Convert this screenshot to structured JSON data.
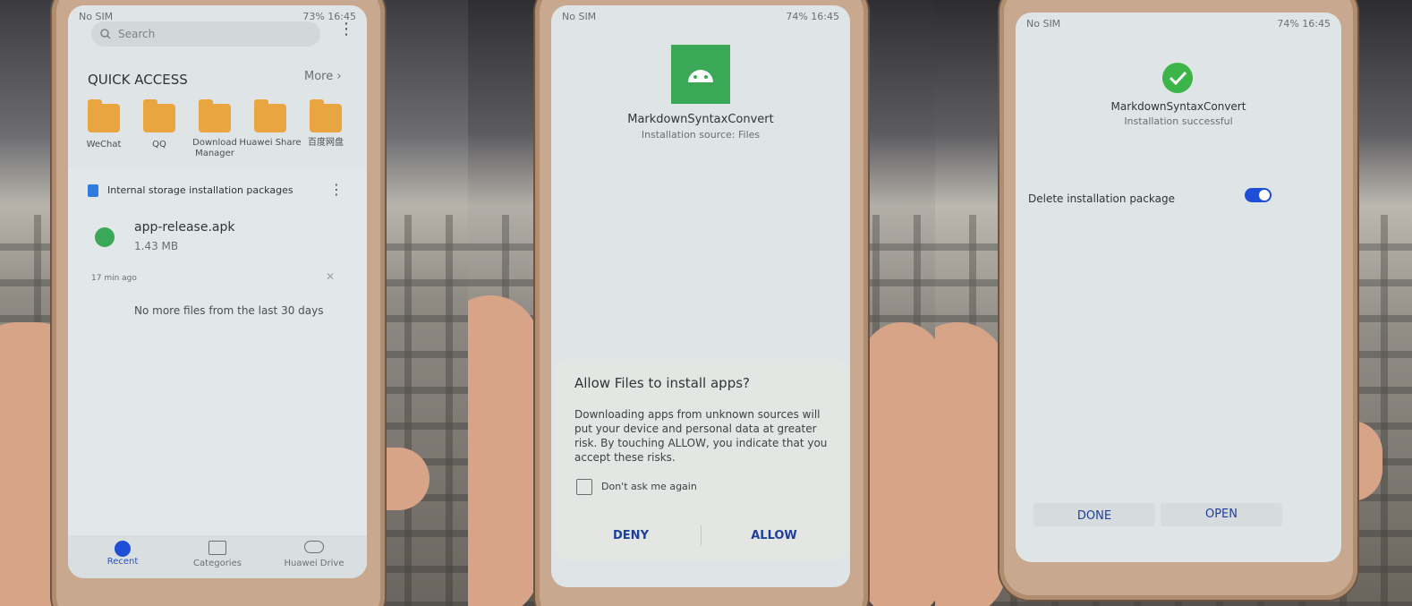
{
  "panel1": {
    "status": {
      "left": "No SIM",
      "right": "73%  16:45"
    },
    "search": {
      "placeholder": "Search"
    },
    "quick_access": {
      "title": "QUICK ACCESS",
      "more": "More",
      "items": [
        {
          "label": "WeChat",
          "icon": "wechat-icon"
        },
        {
          "label": "QQ",
          "icon": "qq-icon"
        },
        {
          "label": "Download Manager",
          "icon": "download-icon"
        },
        {
          "label": "Huawei Share",
          "icon": "share-icon"
        },
        {
          "label": "百度网盘",
          "icon": "folder-icon"
        }
      ]
    },
    "section_title": "Internal storage installation packages",
    "file": {
      "name": "app-release.apk",
      "size": "1.43 MB",
      "time": "17 min ago"
    },
    "empty_message": "No more files from the last 30 days",
    "nav": {
      "recent": "Recent",
      "categories": "Categories",
      "drive": "Huawei Drive"
    },
    "accent": "#1e4fd6"
  },
  "panel2": {
    "status": {
      "left": "No SIM",
      "right": "74%  16:45"
    },
    "app_name": "MarkdownSyntaxConvert",
    "source": "Installation source: Files",
    "dialog": {
      "title": "Allow Files to install apps?",
      "body": "Downloading apps from unknown sources will put your device and personal data at greater risk. By touching ALLOW, you indicate that you accept these risks.",
      "checkbox": "Don't ask me again",
      "deny": "DENY",
      "allow": "ALLOW"
    },
    "app_icon_color": "#3aa856"
  },
  "panel3": {
    "status": {
      "left": "No SIM",
      "right": "74%  16:45"
    },
    "app_name": "MarkdownSyntaxConvert",
    "result": "Installation successful",
    "delete_label": "Delete installation package",
    "delete_enabled": true,
    "done": "DONE",
    "open": "OPEN",
    "success_color": "#3bb54a"
  }
}
